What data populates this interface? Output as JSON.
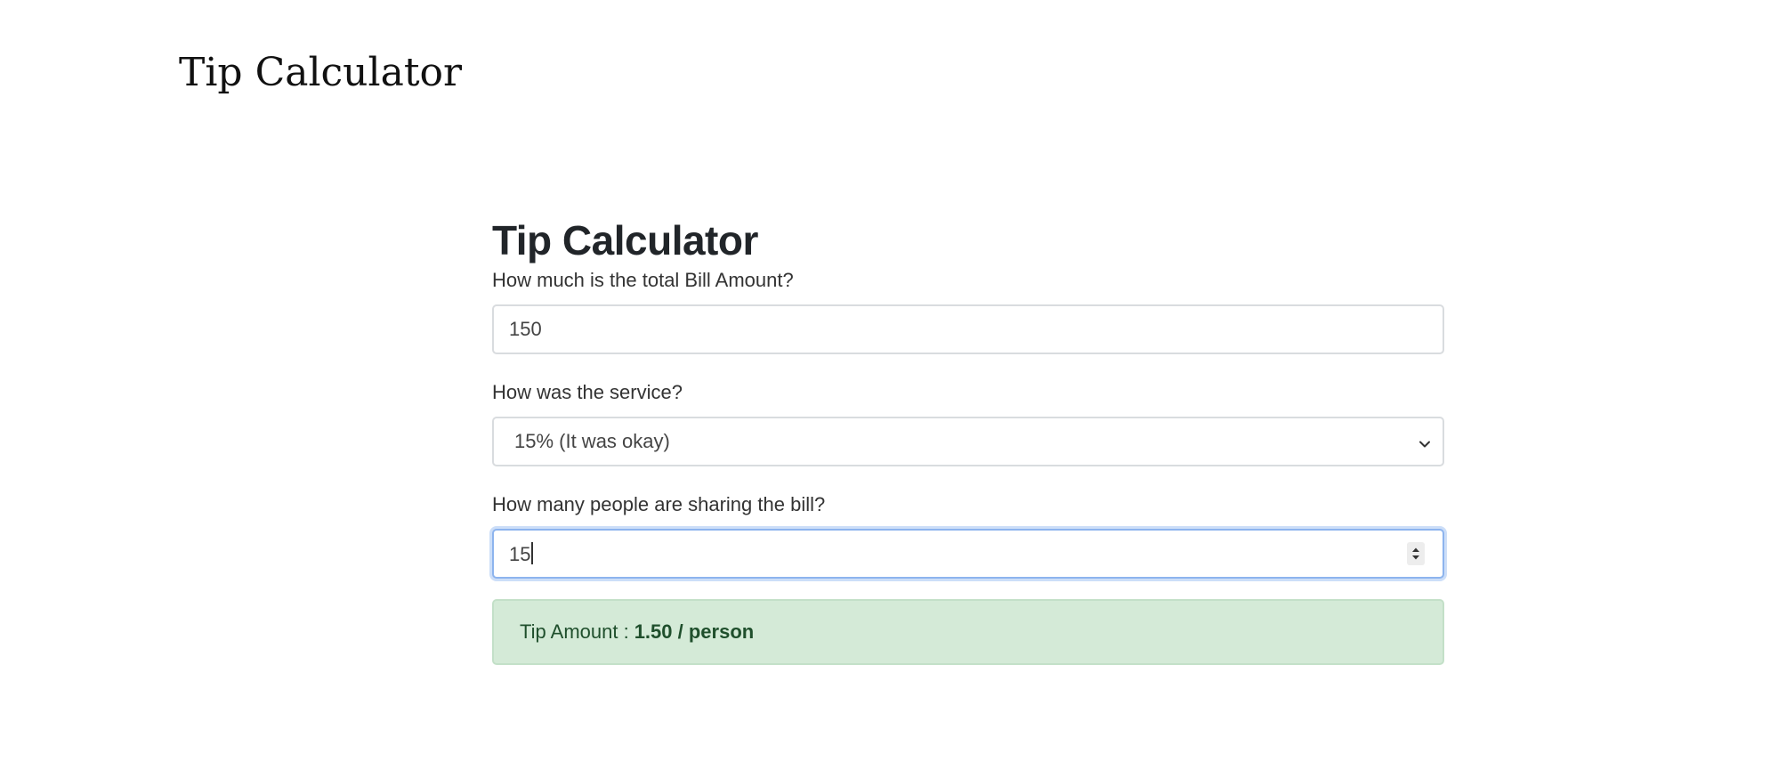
{
  "page": {
    "title": "Tip Calculator"
  },
  "calculator": {
    "title": "Tip Calculator",
    "bill": {
      "label": "How much is the total Bill Amount?",
      "value": "150"
    },
    "service": {
      "label": "How was the service?",
      "selected": "15% (It was okay)"
    },
    "people": {
      "label": "How many people are sharing the bill?",
      "value": "15"
    },
    "result": {
      "prefix": "Tip Amount :",
      "amount": "1.50 / person"
    }
  },
  "icons": {
    "select": "chevron-down-icon",
    "stepper": "spinner-arrows-icon"
  },
  "colors": {
    "result_background": "#d4ead7",
    "result_text": "#1f4f2c",
    "focus_ring": "#8db4ee"
  }
}
